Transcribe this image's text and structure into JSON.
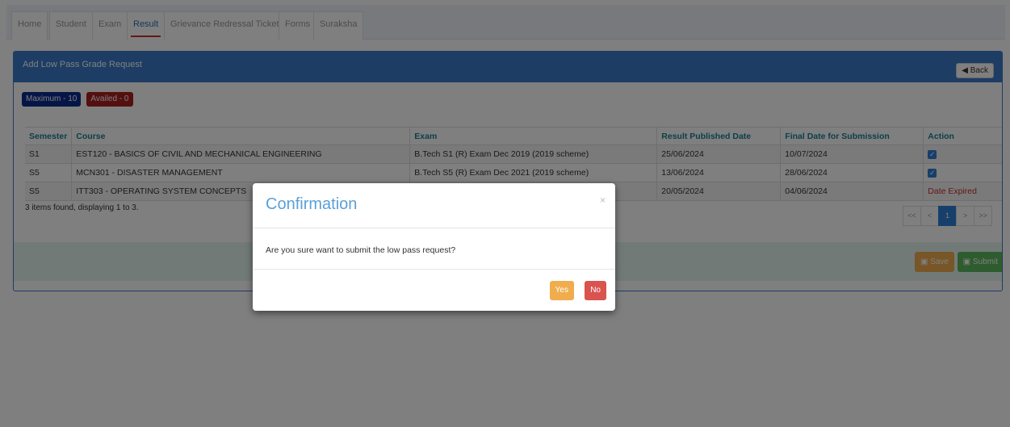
{
  "nav": {
    "tabs": [
      "Home",
      "Student",
      "Exam",
      "Result",
      "Grievance Redressal Tickets",
      "Forms",
      "Suraksha"
    ],
    "active": "Result"
  },
  "panel": {
    "title": "Add Low Pass Grade Request",
    "back_label": "Back"
  },
  "badges": {
    "maximum": "Maximum - 10",
    "availed": "Availed - 0"
  },
  "table": {
    "headers": [
      "Semester",
      "Course",
      "Exam",
      "Result Published Date",
      "Final Date for Submission",
      "Action"
    ],
    "rows": [
      {
        "semester": "S1",
        "course": "EST120 - BASICS OF CIVIL AND MECHANICAL ENGINEERING",
        "exam": "B.Tech S1 (R) Exam Dec 2019 (2019 scheme)",
        "published": "25/06/2024",
        "final": "10/07/2024",
        "action": "checked"
      },
      {
        "semester": "S5",
        "course": "MCN301 - DISASTER MANAGEMENT",
        "exam": "B.Tech S5 (R) Exam Dec 2021 (2019 scheme)",
        "published": "13/06/2024",
        "final": "28/06/2024",
        "action": "checked"
      },
      {
        "semester": "S5",
        "course": "ITT303 - OPERATING SYSTEM CONCEPTS",
        "exam": "",
        "published": "20/05/2024",
        "final": "04/06/2024",
        "action": "Date Expired"
      }
    ],
    "summary": "3 items found, displaying 1 to 3."
  },
  "pager": {
    "first": "<<",
    "prev": "<",
    "current": "1",
    "next": ">",
    "last": ">>"
  },
  "footer": {
    "save_label": "Save",
    "submit_label": "Submit"
  },
  "modal": {
    "title": "Confirmation",
    "close": "×",
    "message": "Are you sure want to submit the low pass request?",
    "yes_label": "Yes",
    "no_label": "No"
  },
  "colors": {
    "panel_header": "#3a7bc8",
    "maximum_badge": "#0b2c8c",
    "availed_badge": "#a8201f",
    "expired_text": "#c9302c",
    "yes_button": "#f0ad4e",
    "no_button": "#d9534f",
    "submit_button": "#5cb85c"
  }
}
